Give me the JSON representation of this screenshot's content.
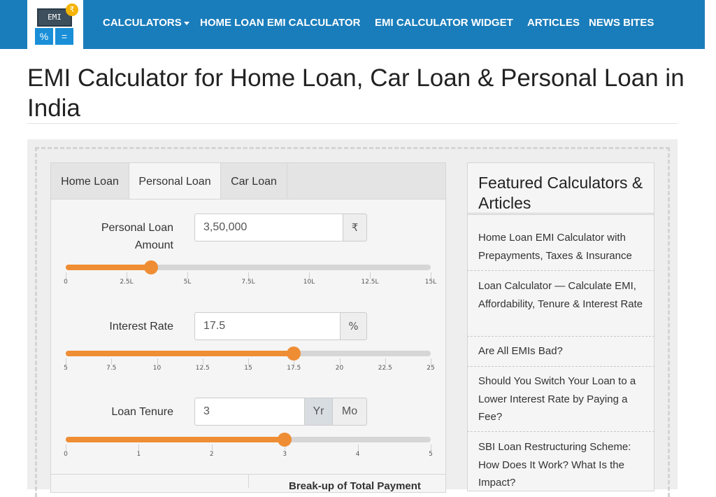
{
  "nav": {
    "logo_text": "EMI",
    "logo_keys": [
      "%",
      "="
    ],
    "logo_coin": "₹",
    "items": [
      {
        "label": "CALCULATORS"
      },
      {
        "label": "HOME LOAN EMI CALCULATOR"
      },
      {
        "label": "EMI CALCULATOR WIDGET"
      },
      {
        "label": "ARTICLES"
      },
      {
        "label": "NEWS BITES"
      }
    ]
  },
  "page": {
    "title": "EMI Calculator for Home Loan, Car Loan & Personal Loan in India"
  },
  "tabs": [
    {
      "label": "Home Loan",
      "active": false
    },
    {
      "label": "Personal Loan",
      "active": true
    },
    {
      "label": "Car Loan",
      "active": false
    }
  ],
  "form": {
    "amount": {
      "label": "Personal Loan Amount",
      "value": "3,50,000",
      "unit": "₹",
      "ticks": [
        "0",
        "2.5L",
        "5L",
        "7.5L",
        "10L",
        "12.5L",
        "15L"
      ],
      "min": 0,
      "max": 1500000,
      "current": 350000
    },
    "rate": {
      "label": "Interest Rate",
      "value": "17.5",
      "unit": "%",
      "ticks": [
        "5",
        "7.5",
        "10",
        "12.5",
        "15",
        "17.5",
        "20",
        "22.5",
        "25"
      ],
      "min": 5,
      "max": 25,
      "current": 17.5
    },
    "tenure": {
      "label": "Loan Tenure",
      "value": "3",
      "unit_year": "Yr",
      "unit_month": "Mo",
      "ticks": [
        "0",
        "1",
        "2",
        "3",
        "4",
        "5"
      ],
      "min": 0,
      "max": 5,
      "current": 3
    },
    "breakup_heading": "Break-up of Total Payment"
  },
  "sidebar": {
    "title": "Featured Calculators & Articles",
    "items": [
      {
        "label": "Home Loan EMI Calculator with Prepayments, Taxes & Insurance"
      },
      {
        "label": "Loan Calculator — Calculate EMI, Affordability, Tenure & Interest Rate"
      },
      {
        "label": "Are All EMIs Bad?"
      },
      {
        "label": "Should You Switch Your Loan to a Lower Interest Rate by Paying a Fee?"
      },
      {
        "label": "SBI Loan Restructuring Scheme: How Does It Work? What Is the Impact?"
      }
    ]
  },
  "colors": {
    "navbar": "#1a7dbb",
    "slider_accent": "#ef8d34"
  }
}
